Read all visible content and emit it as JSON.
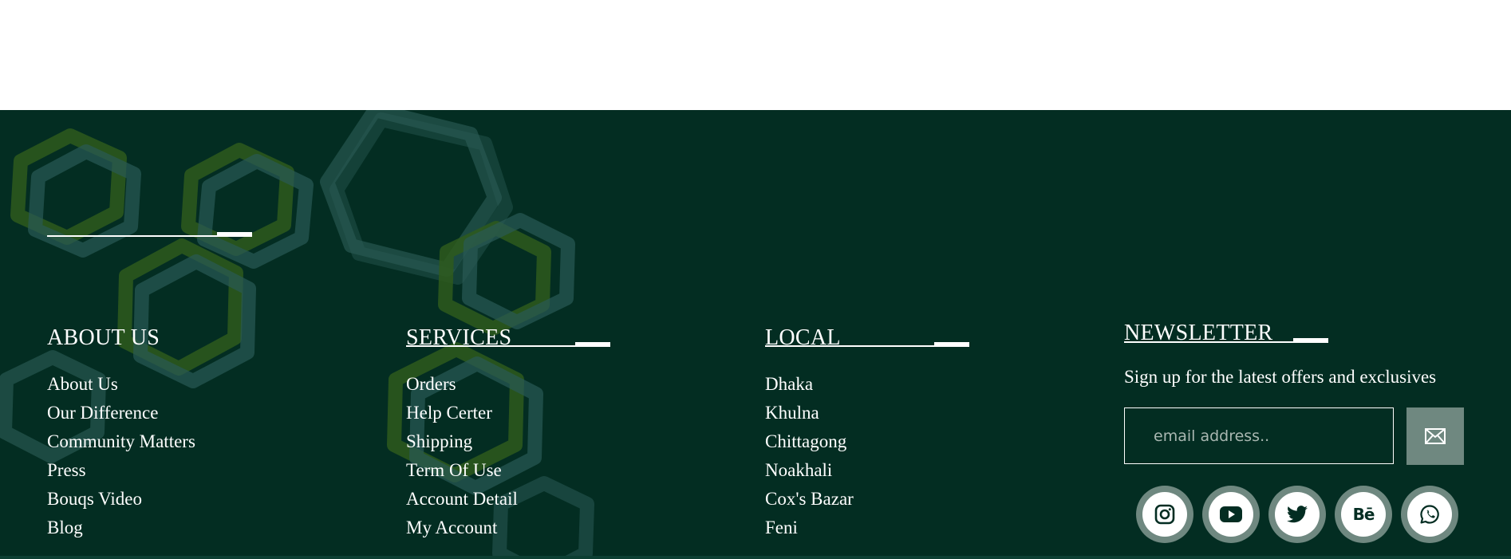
{
  "colors": {
    "footer_bg": "#032d22",
    "accent_muted": "#6f8880",
    "text": "#ffffff",
    "hex_green": "#2e5a1c",
    "hex_teal": "#2a5a55"
  },
  "about": {
    "title": "ABOUT US",
    "links": [
      "About Us",
      "Our Difference",
      "Community Matters",
      "Press",
      "Bouqs Video",
      "Blog"
    ]
  },
  "services": {
    "title": "SERVICES",
    "links": [
      "Orders",
      "Help Certer",
      "Shipping",
      "Term Of Use",
      "Account Detail",
      "My Account"
    ]
  },
  "local": {
    "title": "LOCAL",
    "links": [
      "Dhaka",
      "Khulna",
      "Chittagong",
      "Noakhali",
      "Cox's Bazar",
      "Feni"
    ]
  },
  "newsletter": {
    "title": "NEWSLETTER",
    "subtitle": "Sign up for the latest offers and exclusives",
    "email_placeholder": "email address..",
    "submit_icon": "envelope-icon"
  },
  "social": [
    {
      "name": "instagram",
      "icon": "instagram-icon"
    },
    {
      "name": "youtube",
      "icon": "youtube-icon"
    },
    {
      "name": "twitter",
      "icon": "twitter-icon"
    },
    {
      "name": "behance",
      "icon": "behance-icon",
      "label": "Bē"
    },
    {
      "name": "whatsapp",
      "icon": "whatsapp-icon"
    }
  ]
}
